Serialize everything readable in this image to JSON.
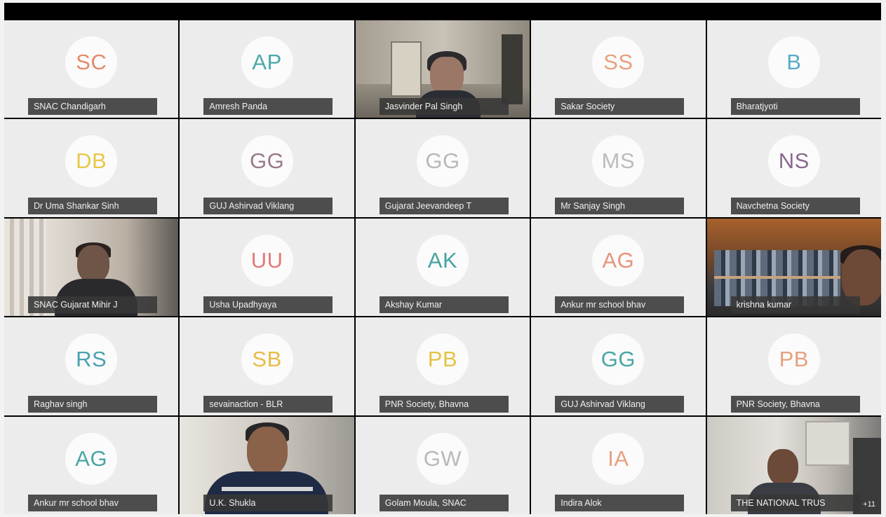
{
  "participants": [
    {
      "name": "SNAC Chandigarh",
      "initials": "SC",
      "color": "#e58a6b"
    },
    {
      "name": "Amresh Panda",
      "initials": "AP",
      "color": "#4ba8a8"
    },
    {
      "name": "Jasvinder Pal Singh",
      "video": "jas"
    },
    {
      "name": "Sakar Society",
      "initials": "SS",
      "color": "#e8a07e"
    },
    {
      "name": "Bharatjyoti",
      "initials": "B",
      "color": "#5aa9c7"
    },
    {
      "name": "Dr Uma Shankar Sinh",
      "initials": "DB",
      "color": "#e8c84a"
    },
    {
      "name": "GUJ Ashirvad Viklang",
      "initials": "GG",
      "color": "#9a7a8c"
    },
    {
      "name": "Gujarat Jeevandeep T",
      "initials": "GG",
      "color": "#b9b9b9"
    },
    {
      "name": "Mr Sanjay Singh",
      "initials": "MS",
      "color": "#bcbcbc"
    },
    {
      "name": "Navchetna Society",
      "initials": "NS",
      "color": "#8a6a90"
    },
    {
      "name": "SNAC Gujarat Mihir J",
      "video": "mihir"
    },
    {
      "name": "Usha Upadhyaya",
      "initials": "UU",
      "color": "#e27a7a"
    },
    {
      "name": "Akshay Kumar",
      "initials": "AK",
      "color": "#46a3a0"
    },
    {
      "name": "Ankur mr school bhav",
      "initials": "AG",
      "color": "#e8937a"
    },
    {
      "name": "krishna kumar",
      "video": "krishna"
    },
    {
      "name": "Raghav singh",
      "initials": "RS",
      "color": "#4aa2b0"
    },
    {
      "name": "sevainaction - BLR",
      "initials": "SB",
      "color": "#e8bd45"
    },
    {
      "name": "PNR Society, Bhavna",
      "initials": "PB",
      "color": "#e3c443"
    },
    {
      "name": "GUJ Ashirvad Viklang",
      "initials": "GG",
      "color": "#4aa6a6"
    },
    {
      "name": "PNR Society, Bhavna",
      "initials": "PB",
      "color": "#e8a07e"
    },
    {
      "name": "Ankur mr school bhav",
      "initials": "AG",
      "color": "#4aa6a6"
    },
    {
      "name": "U.K. Shukla",
      "video": "shukla"
    },
    {
      "name": "Golam Moula, SNAC",
      "initials": "GW",
      "color": "#b9b9b9"
    },
    {
      "name": "Indira Alok",
      "initials": "IA",
      "color": "#e8a07e"
    },
    {
      "name": "THE NATIONAL TRUS",
      "video": "trust"
    }
  ],
  "extra_count": "+11"
}
